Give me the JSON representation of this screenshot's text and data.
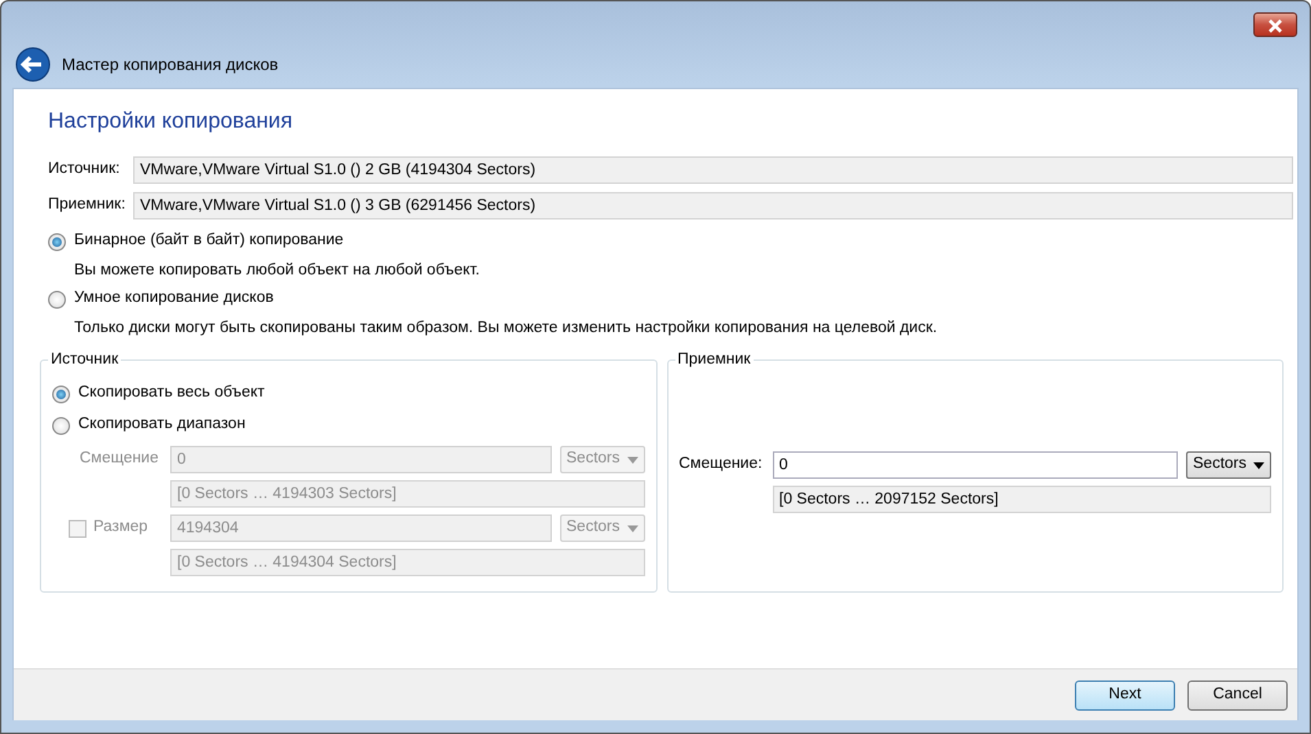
{
  "header": {
    "title": "Мастер копирования дисков"
  },
  "page": {
    "heading": "Настройки копирования",
    "disks": [
      {
        "label": "Источник:",
        "value": "VMware,VMware Virtual S1.0 () 2 GB (4194304 Sectors)"
      },
      {
        "label": "Приемник:",
        "value": "VMware,VMware Virtual S1.0 () 3 GB (6291456 Sectors)"
      }
    ],
    "modes": [
      {
        "label": "Бинарное (байт в байт) копирование",
        "description": "Вы можете копировать любой объект на любой объект.",
        "selected": true
      },
      {
        "label": "Умное копирование дисков",
        "description": "Только диски могут быть скопированы таким образом. Вы можете изменить настройки копирования на целевой диск.",
        "selected": false
      }
    ],
    "source_group": {
      "title": "Источник",
      "options": [
        {
          "label": "Скопировать весь объект",
          "selected": true
        },
        {
          "label": "Скопировать диапазон",
          "selected": false
        }
      ],
      "offset": {
        "label": "Смещение",
        "value": "0",
        "unit": "Sectors",
        "range": "[0 Sectors … 4194303 Sectors]",
        "disabled": true
      },
      "size": {
        "label": "Размер",
        "checked": false,
        "value": "4194304",
        "unit": "Sectors",
        "range": "[0 Sectors … 4194304 Sectors]",
        "disabled": true
      }
    },
    "target_group": {
      "title": "Приемник",
      "offset": {
        "label": "Смещение:",
        "value": "0",
        "unit": "Sectors",
        "range": "[0 Sectors … 2097152 Sectors]",
        "disabled": false
      }
    }
  },
  "buttons": [
    {
      "label": "Next",
      "default": true
    },
    {
      "label": "Cancel",
      "default": false
    }
  ]
}
